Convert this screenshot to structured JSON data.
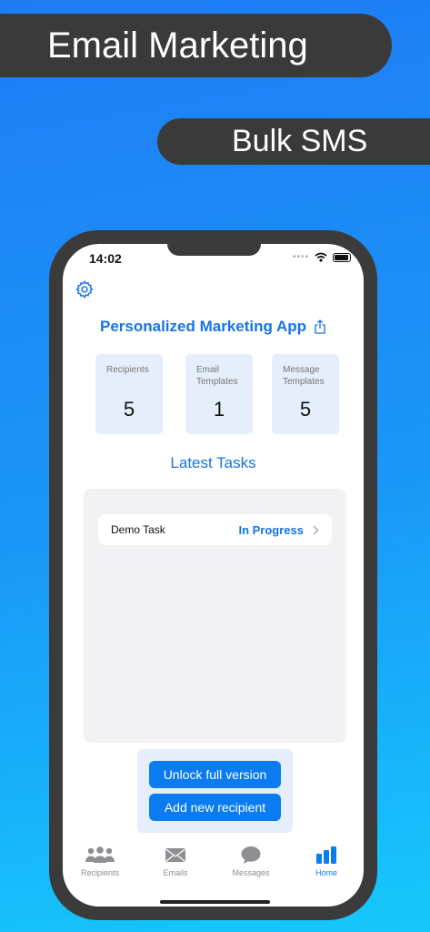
{
  "banner": {
    "top_text": "Email Marketing",
    "bottom_text": "Bulk SMS"
  },
  "status_bar": {
    "time": "14:02"
  },
  "header": {
    "title": "Personalized Marketing App"
  },
  "stats": [
    {
      "label": "Recipients",
      "value": "5"
    },
    {
      "label": "Email Templates",
      "value": "1"
    },
    {
      "label": "Message Templates",
      "value": "5"
    }
  ],
  "latest": {
    "heading": "Latest Tasks"
  },
  "tasks": [
    {
      "name": "Demo Task",
      "status": "In Progress"
    }
  ],
  "actions": {
    "unlock_label": "Unlock full version",
    "add_label": "Add new recipient"
  },
  "tabs": [
    {
      "label": "Recipients",
      "icon": "people-icon"
    },
    {
      "label": "Emails",
      "icon": "envelope-icon"
    },
    {
      "label": "Messages",
      "icon": "chat-bubble-icon"
    },
    {
      "label": "Home",
      "icon": "bar-chart-icon",
      "active": true
    }
  ],
  "colors": {
    "accent": "#1574e8",
    "button": "#0b7bf2",
    "card": "#e5eefb",
    "banner": "#3a3a3a"
  }
}
